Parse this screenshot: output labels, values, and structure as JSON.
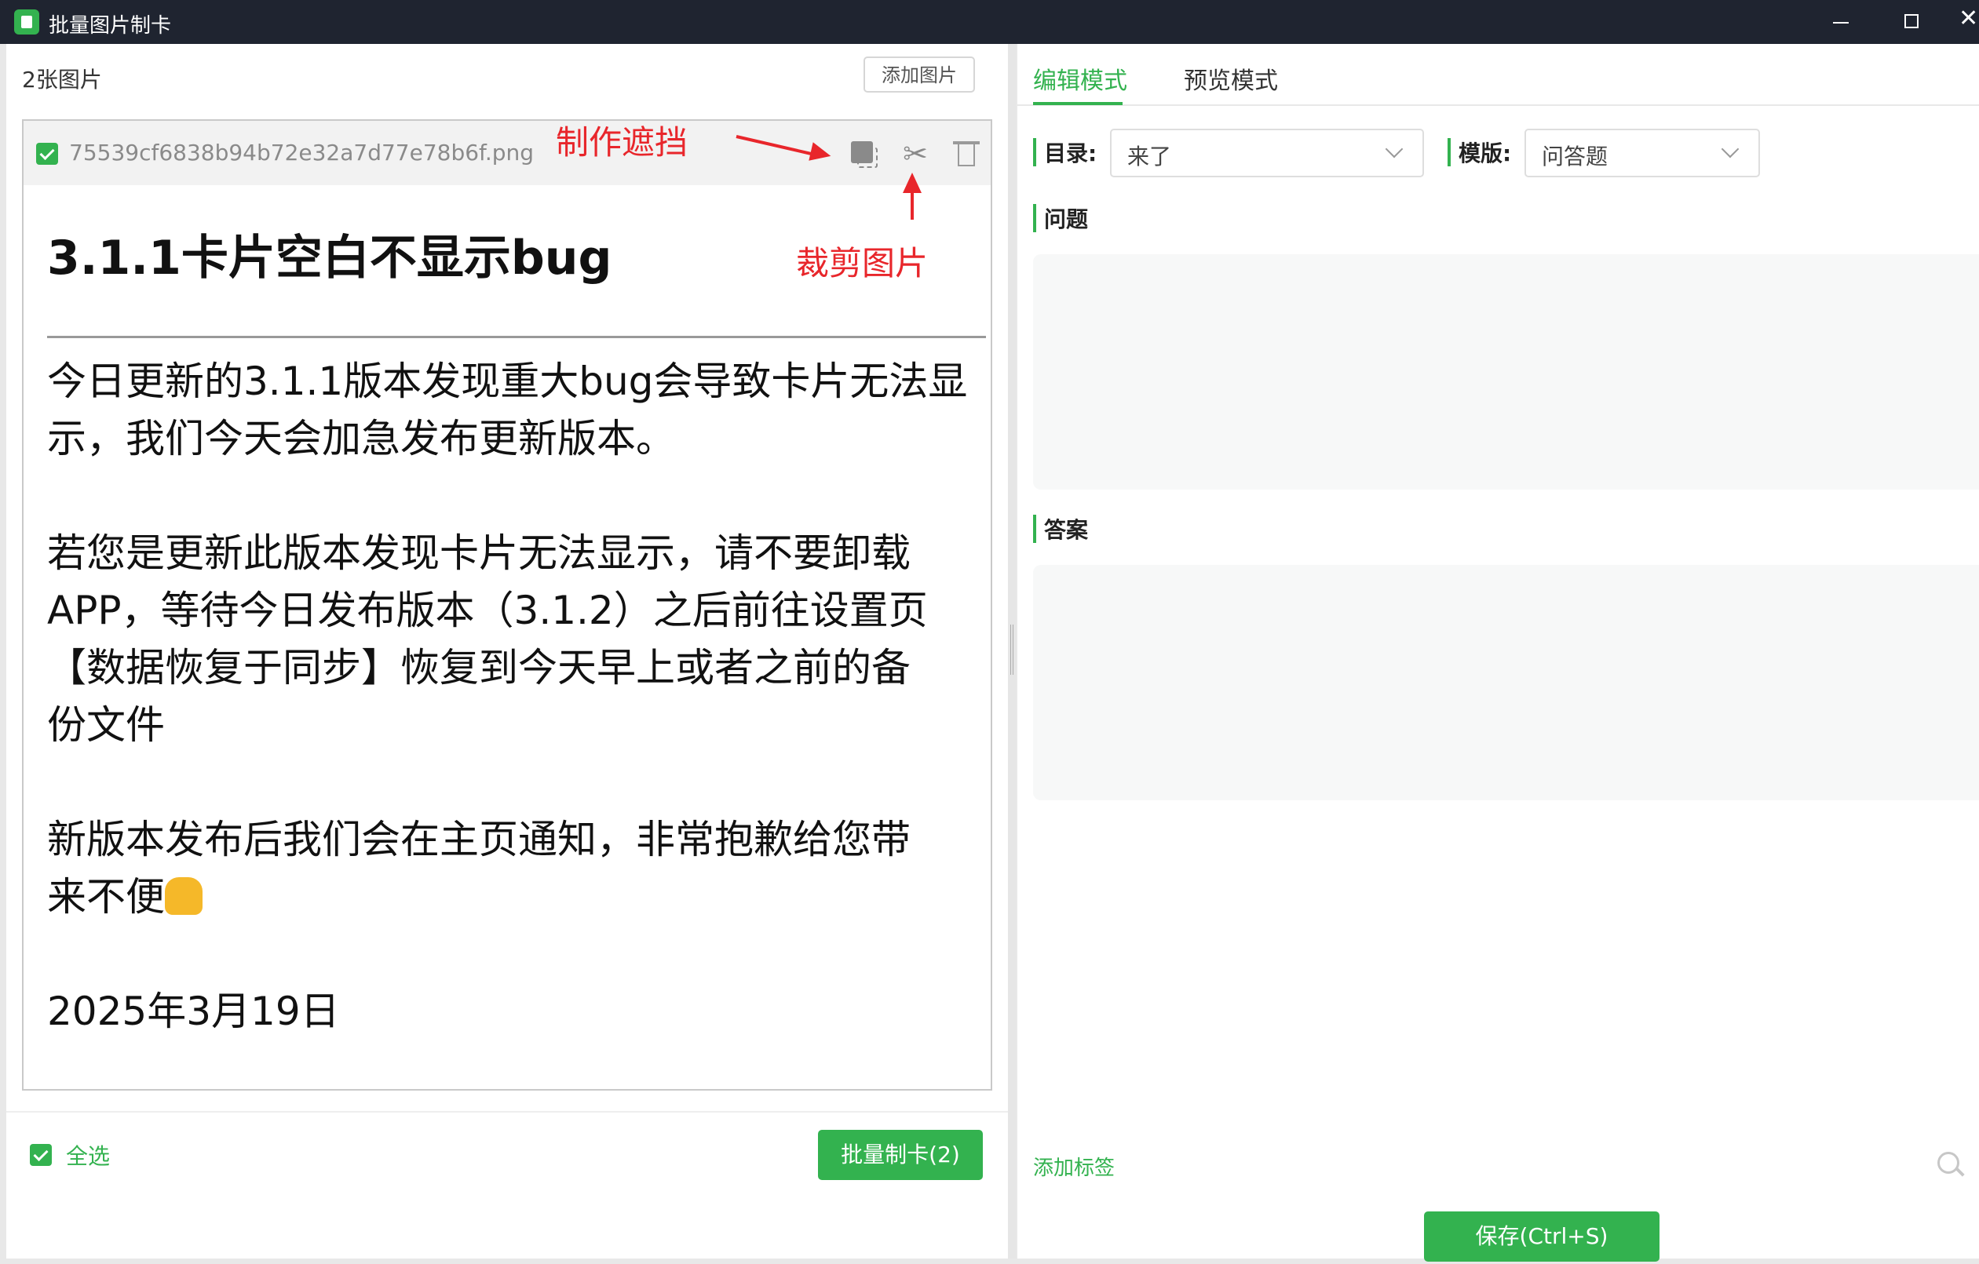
{
  "window": {
    "title": "批量图片制卡",
    "close_symbol": "✕"
  },
  "left": {
    "image_count": "2张图片",
    "add_image_label": "添加图片",
    "card": {
      "filename": "75539cf6838b94b72e32a7d77e78b6f.png",
      "icons": [
        "mask-icon",
        "scissors-icon",
        "trash-icon"
      ],
      "scissors_glyph": "✂",
      "image_text": {
        "title": "3.1.1卡片空白不显示bug",
        "para1_line1": "今日更新的3.1.1版本发现重大bug会导致卡片无法显",
        "para1_line2": "示，我们今天会加急发布更新版本。",
        "para2_line1": "若您是更新此版本发现卡片无法显示，请不要卸载",
        "para2_line2": "APP，等待今日发布版本（3.1.2）之后前往设置页",
        "para2_line3": "【数据恢复于同步】恢复到今天早上或者之前的备",
        "para2_line4": "份文件",
        "para3_line1": "新版本发布后我们会在主页通知，非常抱歉给您带",
        "para3_line2": "来不便",
        "date": "2025年3月19日"
      }
    },
    "annotations": {
      "mask": "制作遮挡",
      "crop": "裁剪图片"
    },
    "select_all_label": "全选",
    "batch_button_label": "批量制卡(2)"
  },
  "right": {
    "tabs": [
      {
        "label": "编辑模式",
        "active": true
      },
      {
        "label": "预览模式",
        "active": false
      }
    ],
    "directory_label": "目录:",
    "directory_value": "来了",
    "template_label": "模版:",
    "template_value": "问答题",
    "question_label": "问题",
    "answer_label": "答案",
    "add_tag_label": "添加标签",
    "save_label": "保存(Ctrl+S)"
  },
  "colors": {
    "accent": "#33b24f",
    "annotation": "#e8262b",
    "titlebar": "#1f2430"
  }
}
